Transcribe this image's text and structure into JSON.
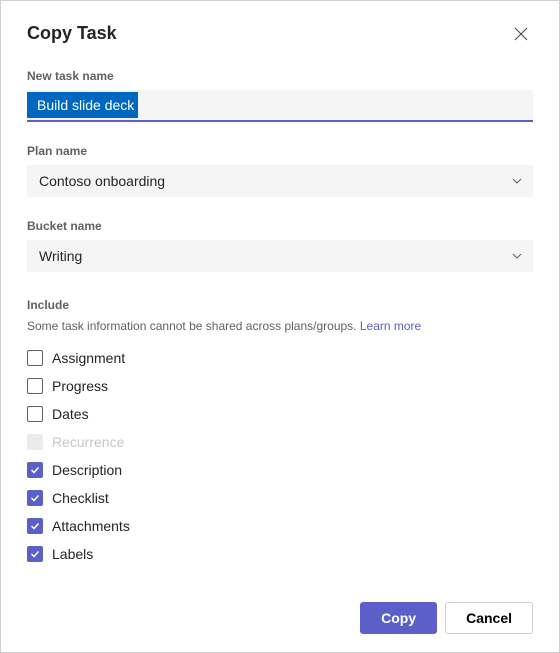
{
  "dialog": {
    "title": "Copy Task",
    "close_icon": "close"
  },
  "fields": {
    "task_name": {
      "label": "New task name",
      "value": "Build slide deck"
    },
    "plan_name": {
      "label": "Plan name",
      "value": "Contoso onboarding"
    },
    "bucket_name": {
      "label": "Bucket name",
      "value": "Writing"
    }
  },
  "include": {
    "label": "Include",
    "caption": "Some task information cannot be shared across plans/groups.",
    "learn_more": "Learn more",
    "items": [
      {
        "label": "Assignment",
        "checked": false,
        "disabled": false
      },
      {
        "label": "Progress",
        "checked": false,
        "disabled": false
      },
      {
        "label": "Dates",
        "checked": false,
        "disabled": false
      },
      {
        "label": "Recurrence",
        "checked": false,
        "disabled": true
      },
      {
        "label": "Description",
        "checked": true,
        "disabled": false
      },
      {
        "label": "Checklist",
        "checked": true,
        "disabled": false
      },
      {
        "label": "Attachments",
        "checked": true,
        "disabled": false
      },
      {
        "label": "Labels",
        "checked": true,
        "disabled": false
      }
    ]
  },
  "buttons": {
    "primary": "Copy",
    "secondary": "Cancel"
  },
  "colors": {
    "accent": "#5b5fc7",
    "selection": "#0067c0"
  }
}
